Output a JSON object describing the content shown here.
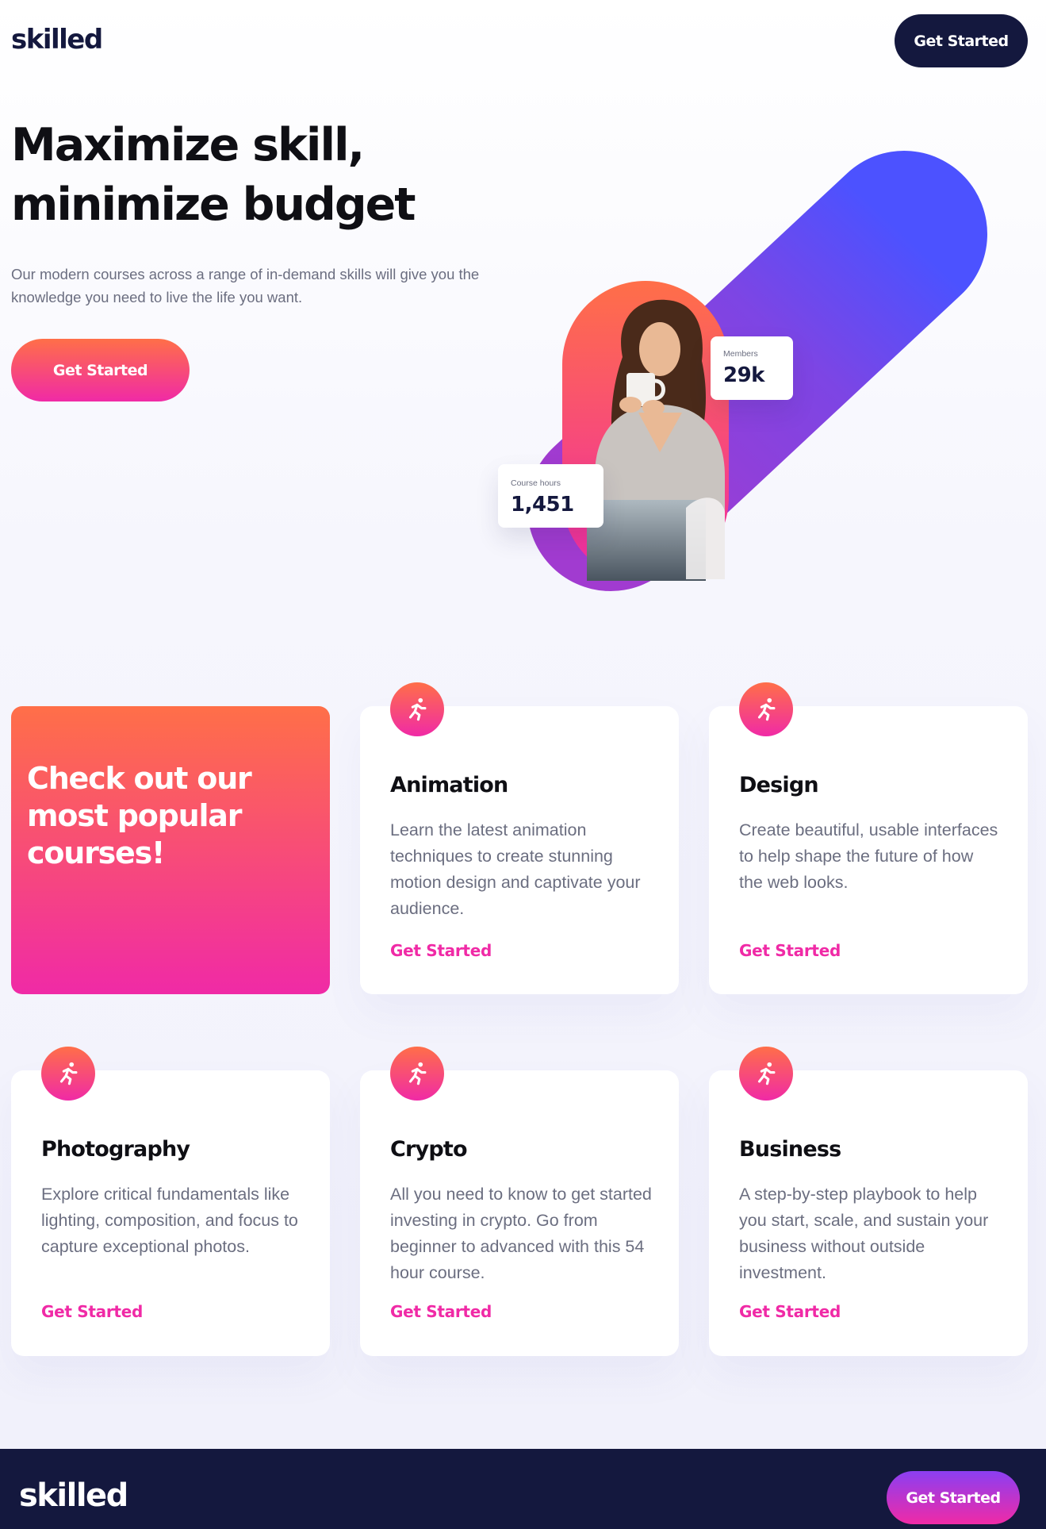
{
  "header": {
    "logo": "skilled",
    "cta_label": "Get Started"
  },
  "hero": {
    "title_line1": "Maximize skill,",
    "title_line2": "minimize budget",
    "subtitle": "Our modern courses across a range of in-demand skills will give you the knowledge you need to live the life you want.",
    "cta_label": "Get Started",
    "stats": {
      "members_label": "Members",
      "members_value": "29k",
      "hours_label": "Course hours",
      "hours_value": "1,451"
    }
  },
  "courses": {
    "promo_title": "Check out our most popular courses!",
    "items": [
      {
        "title": "Animation",
        "description": "Learn the latest animation techniques to create stunning motion design and captivate your audience.",
        "link": "Get Started",
        "icon": "running-person-icon"
      },
      {
        "title": "Design",
        "description": "Create beautiful, usable interfaces to help shape the future of how the web looks.",
        "link": "Get Started",
        "icon": "running-person-icon"
      },
      {
        "title": "Photography",
        "description": "Explore critical fundamentals like lighting, composition, and focus to capture exceptional photos.",
        "link": "Get Started",
        "icon": "running-person-icon"
      },
      {
        "title": "Crypto",
        "description": "All you need to know to get started investing in crypto. Go from beginner to advanced with this 54 hour course.",
        "link": "Get Started",
        "icon": "running-person-icon"
      },
      {
        "title": "Business",
        "description": "A step-by-step playbook to help you start, scale, and sustain your business without outside investment.",
        "link": "Get Started",
        "icon": "running-person-icon"
      }
    ]
  },
  "footer": {
    "logo": "skilled",
    "cta_label": "Get Started"
  },
  "colors": {
    "navy": "#14183e",
    "accent_orange": "#ff6f48",
    "accent_pink": "#f02aa6",
    "accent_purple": "#8b3ff2",
    "accent_blue": "#4c52ff"
  }
}
